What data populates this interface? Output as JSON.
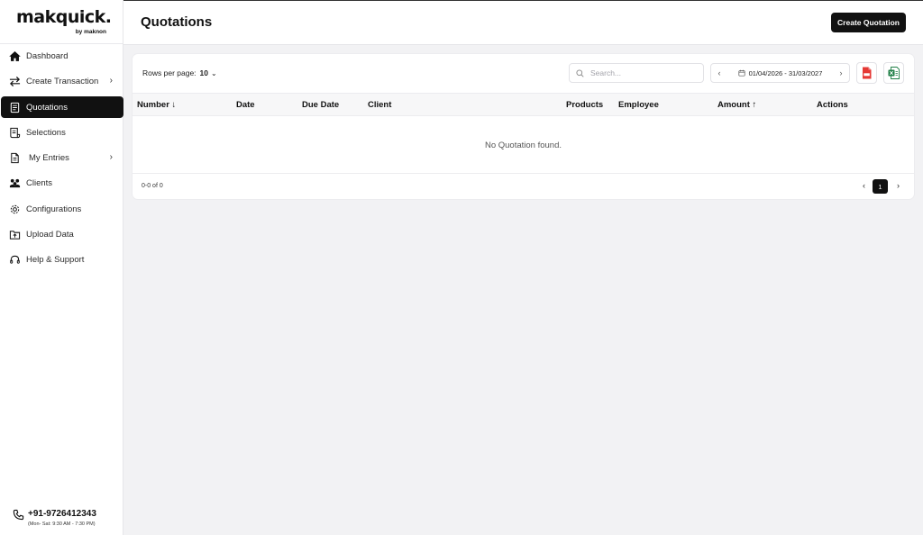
{
  "brand": {
    "name": "makquick.",
    "tagline": "by maknon"
  },
  "sidebar": {
    "items": [
      {
        "label": "Dashboard"
      },
      {
        "label": "Create Transaction",
        "chevron": "›"
      },
      {
        "label": "Quotations",
        "active": true
      },
      {
        "label": "Selections"
      },
      {
        "label": "My Entries",
        "chevron": "›"
      },
      {
        "label": "Clients"
      },
      {
        "label": "Configurations"
      },
      {
        "label": "Upload Data"
      },
      {
        "label": "Help & Support"
      }
    ],
    "contact": {
      "phone": "+91-9726412343",
      "hours": "(Mon- Sat: 9:30 AM - 7:30 PM)"
    }
  },
  "header": {
    "title": "Quotations",
    "create_label": "Create Quotation"
  },
  "toolbar": {
    "rows_label": "Rows per page:",
    "rows_value": "10",
    "search_placeholder": "Search...",
    "date_range": "01/04/2026 - 31/03/2027",
    "prev": "‹",
    "next": "›"
  },
  "table": {
    "columns": [
      "Number ↓",
      "Date",
      "Due Date",
      "Client",
      "Products",
      "Employee",
      "Amount ↑",
      "Actions"
    ],
    "empty_message": "No Quotation found.",
    "footer_range": "0-0 of 0",
    "current_page": "1"
  },
  "colors": {
    "accent": "#111111",
    "pdf": "#e53935",
    "excel": "#1e7e45",
    "background": "#f2f2f4"
  }
}
